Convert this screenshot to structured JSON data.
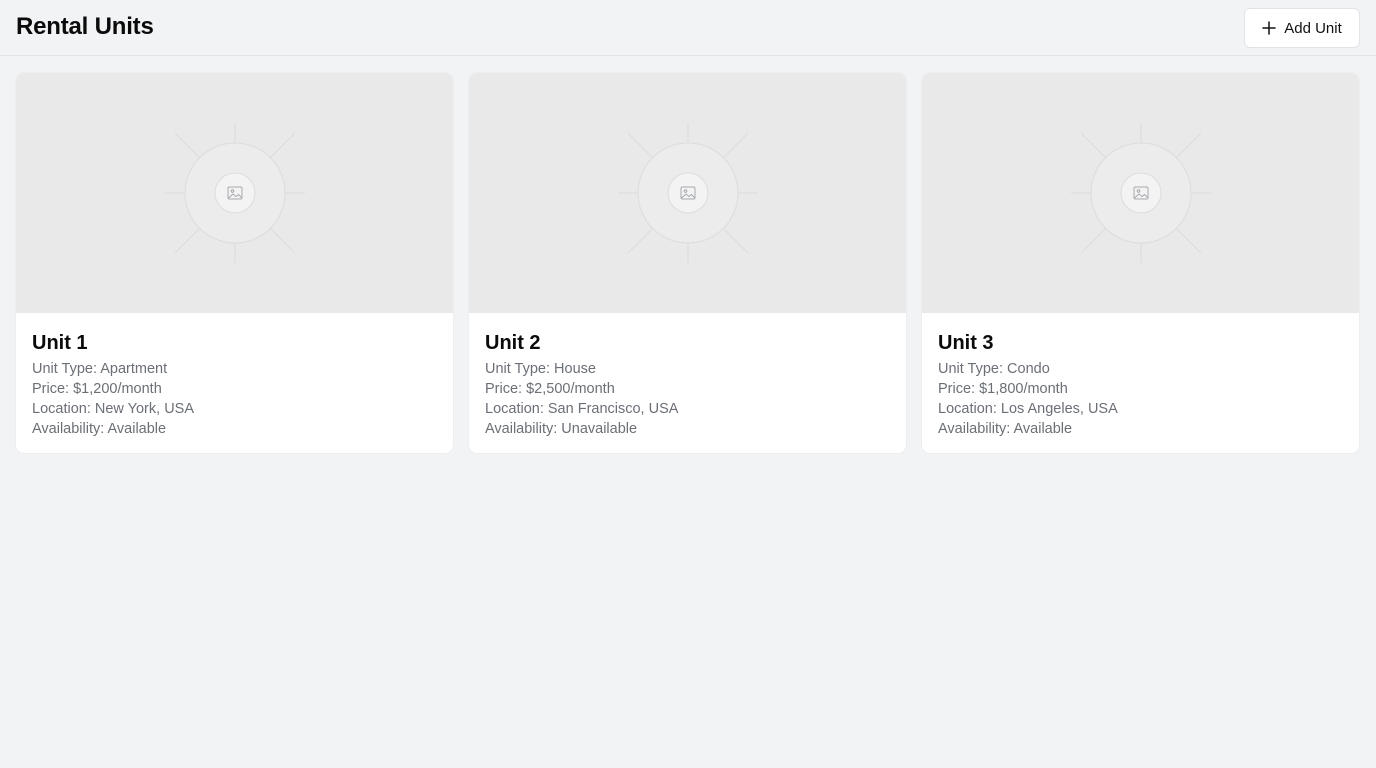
{
  "header": {
    "title": "Rental Units",
    "add_button_label": "Add Unit",
    "add_button_icon": "plus-icon"
  },
  "units": [
    {
      "name": "Unit 1",
      "image_icon": "image-placeholder-icon",
      "type_line": "Unit Type: Apartment",
      "price_line": "Price: $1,200/month",
      "location_line": "Location: New York, USA",
      "availability_line": "Availability: Available"
    },
    {
      "name": "Unit 2",
      "image_icon": "image-placeholder-icon",
      "type_line": "Unit Type: House",
      "price_line": "Price: $2,500/month",
      "location_line": "Location: San Francisco, USA",
      "availability_line": "Availability: Unavailable"
    },
    {
      "name": "Unit 3",
      "image_icon": "image-placeholder-icon",
      "type_line": "Unit Type: Condo",
      "price_line": "Price: $1,800/month",
      "location_line": "Location: Los Angeles, USA",
      "availability_line": "Availability: Available"
    }
  ],
  "colors": {
    "page_background": "#f2f3f5",
    "card_background": "#ffffff",
    "image_placeholder": "#e9e9ea",
    "muted_text": "#6b6f76"
  }
}
